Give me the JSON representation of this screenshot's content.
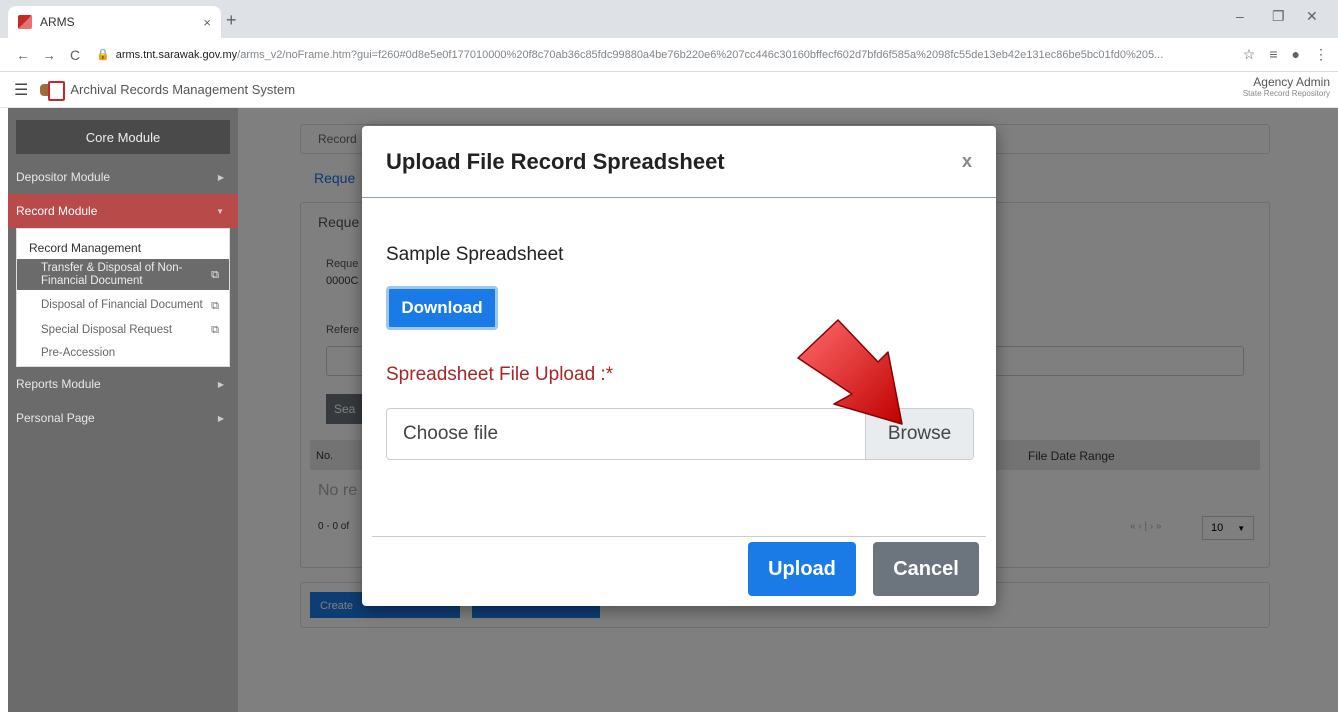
{
  "browser": {
    "tab_title": "ARMS",
    "url_host": "arms.tnt.sarawak.gov.my",
    "url_path": "/arms_v2/noFrame.htm?gui=f260#0d8e5e0f177010000%20f8c70ab36c85fdc99880a4be76b220e6%207cc446c30160bffecf602d7bfd6f585a%2098fc55de13eb42e131ec86be5bc01fd0%205..."
  },
  "app": {
    "title": "Archival Records Management System",
    "user_name": "Agency Admin",
    "user_role": "State Record Repository"
  },
  "sidebar": {
    "core": "Core Module",
    "depositor": "Depositor Module",
    "record": "Record Module",
    "sub_heading": "Record Management",
    "items": [
      {
        "label": "Transfer & Disposal of Non-Financial Document"
      },
      {
        "label": "Disposal of Financial Document"
      },
      {
        "label": "Special Disposal Request"
      },
      {
        "label": "Pre-Accession"
      }
    ],
    "reports": "Reports Module",
    "personal": "Personal Page"
  },
  "background": {
    "breadcrumb": "Record",
    "link": "Reque",
    "panel_head": "Reque",
    "req_label": "Reque",
    "req_value": "0000C",
    "ref_label": "Refere",
    "search_btn": "Sea",
    "col_no": "No.",
    "col_range": "File Date Range",
    "no_records": "No re",
    "pagination": "0 - 0 of",
    "pagenav": "« ‹ | › »",
    "page_size": "10",
    "create_btn": "Create"
  },
  "modal": {
    "title": "Upload File Record Spreadsheet",
    "close": "x",
    "sample_label": "Sample Spreadsheet",
    "download": "Download",
    "upload_label": "Spreadsheet File Upload :*",
    "file_placeholder": "Choose file",
    "browse": "Browse",
    "upload": "Upload",
    "cancel": "Cancel"
  }
}
